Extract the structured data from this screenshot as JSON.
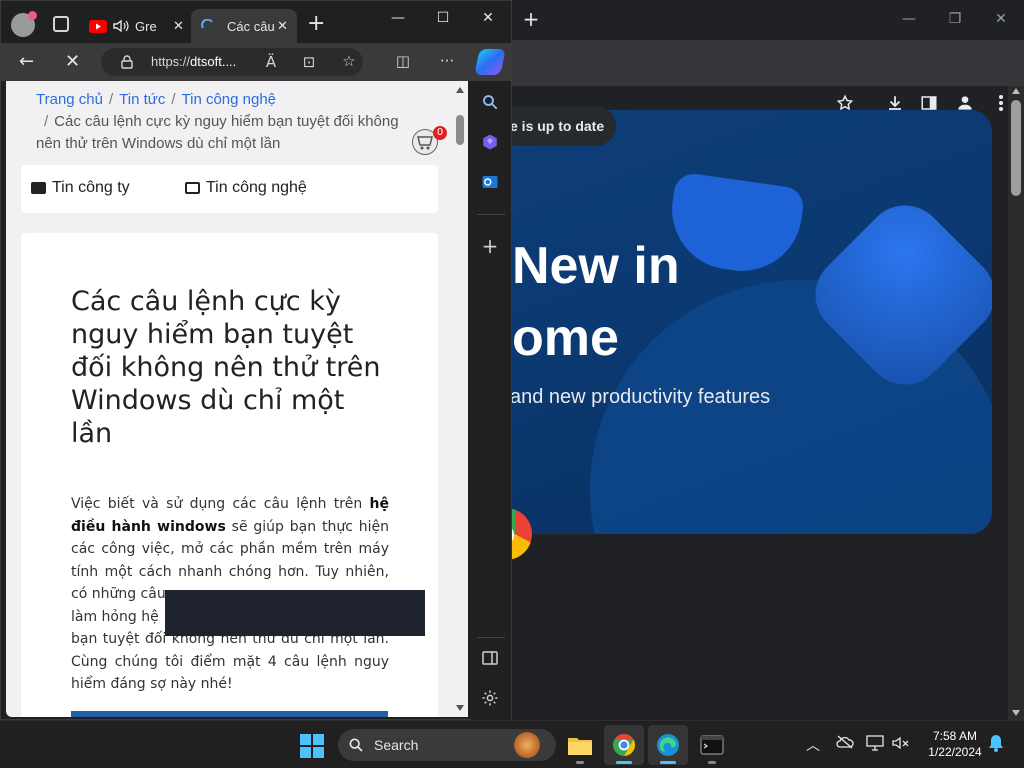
{
  "chrome": {
    "toolbar_icons": [
      "star-icon",
      "download-icon",
      "sidepanel-icon",
      "profile-icon",
      "more-icon"
    ],
    "page": {
      "pill_text": "e is up to date",
      "title_line1": "New in",
      "title_line2": "ome",
      "subtitle": "and new productivity features"
    }
  },
  "edge": {
    "tabs": [
      {
        "label": "Gre",
        "icon": "youtube-icon",
        "audio": true
      },
      {
        "label": "Các câu",
        "icon": "loading-icon",
        "active": true
      }
    ],
    "address": {
      "prefix": "https://",
      "domain": "dtsoft...."
    },
    "breadcrumb": {
      "items": [
        "Trang chủ",
        "Tin tức",
        "Tin công nghệ"
      ],
      "current": "Các câu lệnh cực kỳ nguy hiểm bạn tuyệt đối không nên thử trên Windows dù chỉ một lần"
    },
    "cart_count": "0",
    "categories": [
      "Tin công ty",
      "Tin công nghệ"
    ],
    "article": {
      "title": "Các câu lệnh cực kỳ nguy hiểm bạn tuyệt đối không nên thử trên Windows dù chỉ một lần",
      "body_1": "Việc biết và sử dụng các câu lệnh trên ",
      "body_bold": "hệ điều hành windows",
      "body_2": " sẽ giúp bạn thực hiện các công việc, mở các phần mềm trên máy tính một cách nhanh chóng hơn. Tuy nhiên, có những câu",
      "body_3": "làm hỏng hệ",
      "body_4": "bạn tuyệt đối không nên thử dù chỉ một lần. Cùng chúng tôi điểm mặt 4 câu lệnh nguy hiểm đáng sợ này nhé!"
    }
  },
  "taskbar": {
    "search_label": "Search",
    "time": "7:58 AM",
    "date": "1/22/2024",
    "accent": "#4cc2ff"
  }
}
